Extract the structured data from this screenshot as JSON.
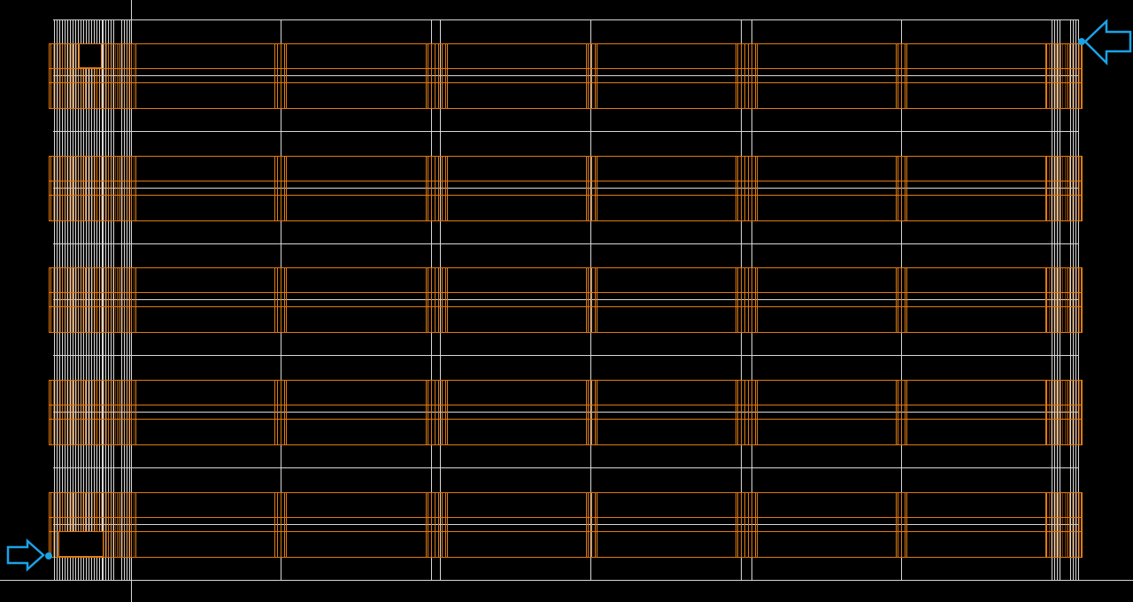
{
  "canvas": {
    "background": "#000000",
    "grid_color": "#d8d8d8",
    "pattern_color": "#e07a10",
    "marker_color": "#1aa3e8"
  },
  "layout_view": {
    "row_band_count": 5,
    "pattern_columns_per_row": 7,
    "markers": [
      {
        "id": "start-marker",
        "icon": "arrow-right-icon",
        "points_to": "bottom-left-corner"
      },
      {
        "id": "end-marker",
        "icon": "arrow-left-icon",
        "points_to": "top-right-corner"
      }
    ]
  }
}
